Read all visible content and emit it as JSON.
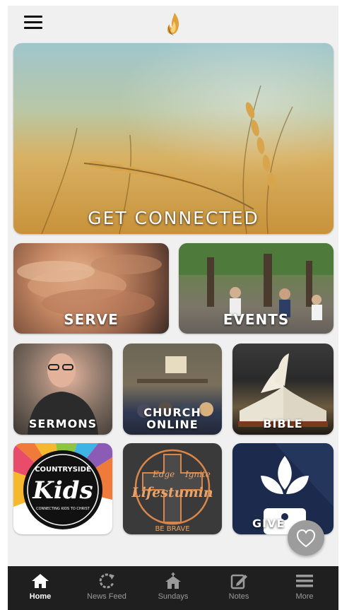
{
  "header": {
    "menu_icon": "hamburger-icon",
    "logo": "flame-logo"
  },
  "tiles": {
    "hero": "GET CONNECTED",
    "serve": "SERVE",
    "events": "EVENTS",
    "sermons": "SERMONS",
    "church_online_line1": "CHURCH",
    "church_online_line2": "ONLINE",
    "bible": "BIBLE",
    "kids_title": "COUNTRYSIDE",
    "kids_big": "Kids",
    "kids_tagline": "CONNECTING KIDS TO CHRIST",
    "life_left": "Edge",
    "life_right": "Ignite",
    "life_title": "Lifestumin",
    "life_tagline": "BE BRAVE",
    "give": "GIVE"
  },
  "tabbar": {
    "items": [
      {
        "label": "Home",
        "icon": "home-icon",
        "active": true
      },
      {
        "label": "News Feed",
        "icon": "refresh-icon",
        "active": false
      },
      {
        "label": "Sundays",
        "icon": "church-icon",
        "active": false
      },
      {
        "label": "Notes",
        "icon": "edit-note-icon",
        "active": false
      },
      {
        "label": "More",
        "icon": "menu-lines-icon",
        "active": false
      }
    ]
  },
  "colors": {
    "tabbar_bg": "#1f1f1f",
    "give_bg": "#1c2b4d",
    "fab_bg": "#9c9c9c"
  }
}
